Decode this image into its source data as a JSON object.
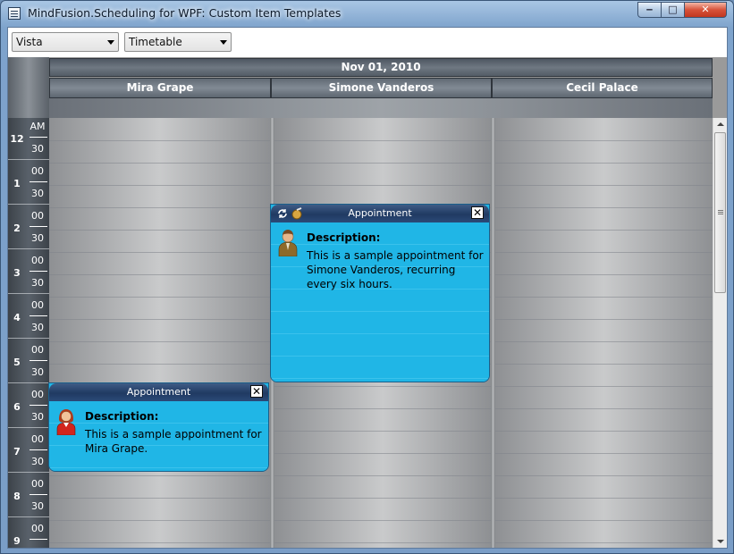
{
  "window": {
    "title": "MindFusion.Scheduling for WPF: Custom Item Templates",
    "min_glyph": "‒",
    "max_glyph": "□",
    "close_glyph": "✕"
  },
  "toolbar": {
    "theme_combo": "Vista",
    "view_combo": "Timetable"
  },
  "schedule": {
    "date": "Nov 01, 2010",
    "resources": [
      "Mira Grape",
      "Simone Vanderos",
      "Cecil Palace"
    ],
    "ampm": "AM",
    "hours": [
      "12",
      "1",
      "2",
      "3",
      "4",
      "5",
      "6",
      "7",
      "8",
      "9"
    ],
    "minutes_top": "30",
    "minutes_half": "00",
    "minutes_bottom": "30"
  },
  "appointments": [
    {
      "resource": "Simone Vanderos",
      "header": "Appointment",
      "desc_title": "Description:",
      "desc": "This is a sample appointment for Simone Vanderos, recurring every six hours.",
      "recurring": true,
      "avatar": "male-user-icon"
    },
    {
      "resource": "Mira Grape",
      "header": "Appointment",
      "desc_title": "Description:",
      "desc": "This is a sample appointment for Mira Grape.",
      "recurring": false,
      "avatar": "female-user-icon"
    }
  ],
  "close_glyph": "✕"
}
